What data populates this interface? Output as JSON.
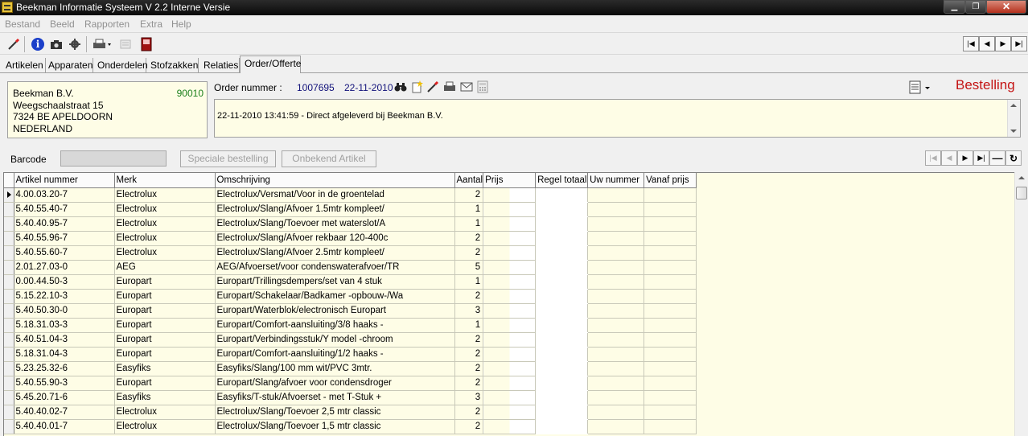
{
  "window": {
    "title": "Beekman Informatie Systeem V 2.2 Interne Versie"
  },
  "menu": [
    "Bestand",
    "Beeld",
    "Rapporten",
    "Extra",
    "Help"
  ],
  "tabs": [
    "Artikelen",
    "Apparaten",
    "Onderdelen",
    "Stofzakken",
    "Relaties",
    "Order/Offerte"
  ],
  "active_tab": "Order/Offerte",
  "customer": {
    "name": "Beekman B.V.",
    "code": "90010",
    "street": "Weegschaalstraat 15",
    "city": "7324 BE  APELDOORN",
    "country": "NEDERLAND"
  },
  "order": {
    "label": "Order nummer :",
    "number": "1007695",
    "date": "22-11-2010",
    "type": "Bestelling",
    "remark": "22-11-2010 13:41:59 - Direct afgeleverd bij Beekman B.V."
  },
  "barcode": {
    "label": "Barcode",
    "value": "",
    "special_order_button": "Speciale bestelling",
    "unknown_article_button": "Onbekend Artikel"
  },
  "grid": {
    "columns": [
      "Artikel nummer",
      "Merk",
      "Omschrijving",
      "Aantal",
      "Prijs",
      "Regel totaal",
      "Uw nummer",
      "Vanaf prijs"
    ],
    "rows": [
      {
        "artikel": "4.00.03.20-7",
        "merk": "Electrolux",
        "omschrijving": "Electrolux/Versmat/Voor in de groentelad",
        "aantal": "2"
      },
      {
        "artikel": "5.40.55.40-7",
        "merk": "Electrolux",
        "omschrijving": "Electrolux/Slang/Afvoer 1.5mtr kompleet/",
        "aantal": "1"
      },
      {
        "artikel": "5.40.40.95-7",
        "merk": "Electrolux",
        "omschrijving": "Electrolux/Slang/Toevoer met waterslot/A",
        "aantal": "1"
      },
      {
        "artikel": "5.40.55.96-7",
        "merk": "Electrolux",
        "omschrijving": "Electrolux/Slang/Afvoer rekbaar 120-400c",
        "aantal": "2"
      },
      {
        "artikel": "5.40.55.60-7",
        "merk": "Electrolux",
        "omschrijving": "Electrolux/Slang/Afvoer 2.5mtr kompleet/",
        "aantal": "2"
      },
      {
        "artikel": "2.01.27.03-0",
        "merk": "AEG",
        "omschrijving": "AEG/Afvoerset/voor condenswaterafvoer/TR",
        "aantal": "5"
      },
      {
        "artikel": "0.00.44.50-3",
        "merk": "Europart",
        "omschrijving": "Europart/Trillingsdempers/set van 4 stuk",
        "aantal": "1"
      },
      {
        "artikel": "5.15.22.10-3",
        "merk": "Europart",
        "omschrijving": "Europart/Schakelaar/Badkamer -opbouw-/Wa",
        "aantal": "2"
      },
      {
        "artikel": "5.40.50.30-0",
        "merk": "Europart",
        "omschrijving": "Europart/Waterblok/electronisch Europart",
        "aantal": "3"
      },
      {
        "artikel": "5.18.31.03-3",
        "merk": "Europart",
        "omschrijving": "Europart/Comfort-aansluiting/3/8 haaks -",
        "aantal": "1"
      },
      {
        "artikel": "5.40.51.04-3",
        "merk": "Europart",
        "omschrijving": "Europart/Verbindingsstuk/Y model -chroom",
        "aantal": "2"
      },
      {
        "artikel": "5.18.31.04-3",
        "merk": "Europart",
        "omschrijving": "Europart/Comfort-aansluiting/1/2 haaks -",
        "aantal": "2"
      },
      {
        "artikel": "5.23.25.32-6",
        "merk": "Easyfiks",
        "omschrijving": "Easyfiks/Slang/100 mm wit/PVC 3mtr.",
        "aantal": "2"
      },
      {
        "artikel": "5.40.55.90-3",
        "merk": "Europart",
        "omschrijving": "Europart/Slang/afvoer voor condensdroger",
        "aantal": "2"
      },
      {
        "artikel": "5.45.20.71-6",
        "merk": "Easyfiks",
        "omschrijving": "Easyfiks/T-stuk/Afvoerset - met T-Stuk +",
        "aantal": "3"
      },
      {
        "artikel": "5.40.40.02-7",
        "merk": "Electrolux",
        "omschrijving": "Electrolux/Slang/Toevoer 2,5 mtr classic",
        "aantal": "2"
      },
      {
        "artikel": "5.40.40.01-7",
        "merk": "Electrolux",
        "omschrijving": "Electrolux/Slang/Toevoer 1,5 mtr classic",
        "aantal": "2"
      }
    ]
  },
  "icons": {
    "toolbar": [
      "wand-icon",
      "info-icon",
      "camera-icon",
      "gear-icon",
      "printer-icon",
      "export-icon",
      "exit-icon"
    ],
    "order_tools": [
      "binoculars-icon",
      "new-document-icon",
      "wand-icon",
      "printer-icon",
      "envelope-icon",
      "calculator-icon"
    ]
  },
  "colors": {
    "panel_bg": "#fefde6",
    "bestelling": "#c41414",
    "customer_code": "#1a7f1a",
    "order_text": "#11117a"
  }
}
